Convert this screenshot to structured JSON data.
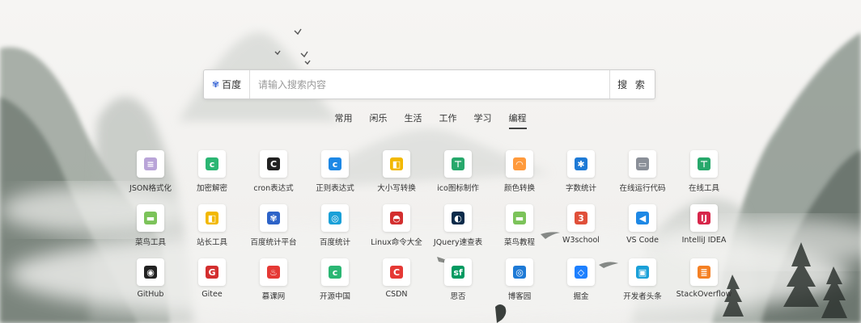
{
  "search": {
    "engine_label": "百度",
    "placeholder": "请输入搜索内容",
    "button_label": "搜 索"
  },
  "tabs": [
    {
      "label": "常用",
      "active": false
    },
    {
      "label": "闲乐",
      "active": false
    },
    {
      "label": "生活",
      "active": false
    },
    {
      "label": "工作",
      "active": false
    },
    {
      "label": "学习",
      "active": false
    },
    {
      "label": "编程",
      "active": true
    }
  ],
  "sites": [
    [
      {
        "label": "JSON格式化",
        "icon": "json-icon",
        "glyph": "≡",
        "color": "#b9a4d8"
      },
      {
        "label": "加密解密",
        "icon": "lock-c-icon",
        "glyph": "c",
        "color": "#2bb673"
      },
      {
        "label": "cron表达式",
        "icon": "cron-icon",
        "glyph": "C",
        "color": "#222222"
      },
      {
        "label": "正则表达式",
        "icon": "regex-icon",
        "glyph": "c",
        "color": "#1e88e5"
      },
      {
        "label": "大小写转换",
        "icon": "case-icon",
        "glyph": "◧",
        "color": "#f2b800"
      },
      {
        "label": "ico图标制作",
        "icon": "ico-icon",
        "glyph": "⊤",
        "color": "#27a86b"
      },
      {
        "label": "颜色转换",
        "icon": "rainbow-icon",
        "glyph": "◠",
        "color": "#ff9a3c"
      },
      {
        "label": "字数统计",
        "icon": "gear-icon",
        "glyph": "✱",
        "color": "#1e7ad6"
      },
      {
        "label": "在线运行代码",
        "icon": "monitor-icon",
        "glyph": "▭",
        "color": "#8a8f98"
      },
      {
        "label": "在线工具",
        "icon": "tool-icon",
        "glyph": "⊤",
        "color": "#27a86b"
      }
    ],
    [
      {
        "label": "菜鸟工具",
        "icon": "runoob-icon",
        "glyph": "▬",
        "color": "#7cc35a"
      },
      {
        "label": "站长工具",
        "icon": "chinaz-icon",
        "glyph": "◧",
        "color": "#f2b800"
      },
      {
        "label": "百度统计平台",
        "icon": "paw-icon",
        "glyph": "✾",
        "color": "#2d63c8"
      },
      {
        "label": "百度统计",
        "icon": "stats-icon",
        "glyph": "◎",
        "color": "#1aa0d8"
      },
      {
        "label": "Linux命令大全",
        "icon": "redhat-icon",
        "glyph": "◓",
        "color": "#d32f2f"
      },
      {
        "label": "JQuery速查表",
        "icon": "jquery-icon",
        "glyph": "◐",
        "color": "#0b2b4a"
      },
      {
        "label": "菜鸟教程",
        "icon": "runoob-icon",
        "glyph": "▬",
        "color": "#7cc35a"
      },
      {
        "label": "W3school",
        "icon": "w3school-icon",
        "glyph": "3",
        "color": "#e0503a"
      },
      {
        "label": "VS Code",
        "icon": "vscode-icon",
        "glyph": "◀",
        "color": "#1e88e5"
      },
      {
        "label": "IntelliJ IDEA",
        "icon": "intellij-icon",
        "glyph": "IJ",
        "color": "#d7264a"
      }
    ],
    [
      {
        "label": "GitHub",
        "icon": "github-icon",
        "glyph": "◉",
        "color": "#222222"
      },
      {
        "label": "Gitee",
        "icon": "gitee-icon",
        "glyph": "G",
        "color": "#d32f2f"
      },
      {
        "label": "慕课网",
        "icon": "imooc-icon",
        "glyph": "♨",
        "color": "#e53935"
      },
      {
        "label": "开源中国",
        "icon": "oschina-icon",
        "glyph": "c",
        "color": "#2bb673"
      },
      {
        "label": "CSDN",
        "icon": "csdn-icon",
        "glyph": "C",
        "color": "#e53935"
      },
      {
        "label": "思否",
        "icon": "segmentfault-icon",
        "glyph": "sf",
        "color": "#019a61"
      },
      {
        "label": "博客园",
        "icon": "cnblogs-icon",
        "glyph": "◎",
        "color": "#1e7ad6"
      },
      {
        "label": "掘金",
        "icon": "juejin-icon",
        "glyph": "◇",
        "color": "#1e80ff"
      },
      {
        "label": "开发者头条",
        "icon": "toutiao-icon",
        "glyph": "▣",
        "color": "#1aa0d8"
      },
      {
        "label": "StackOverflow",
        "icon": "stackoverflow-icon",
        "glyph": "≣",
        "color": "#f48024"
      }
    ]
  ]
}
